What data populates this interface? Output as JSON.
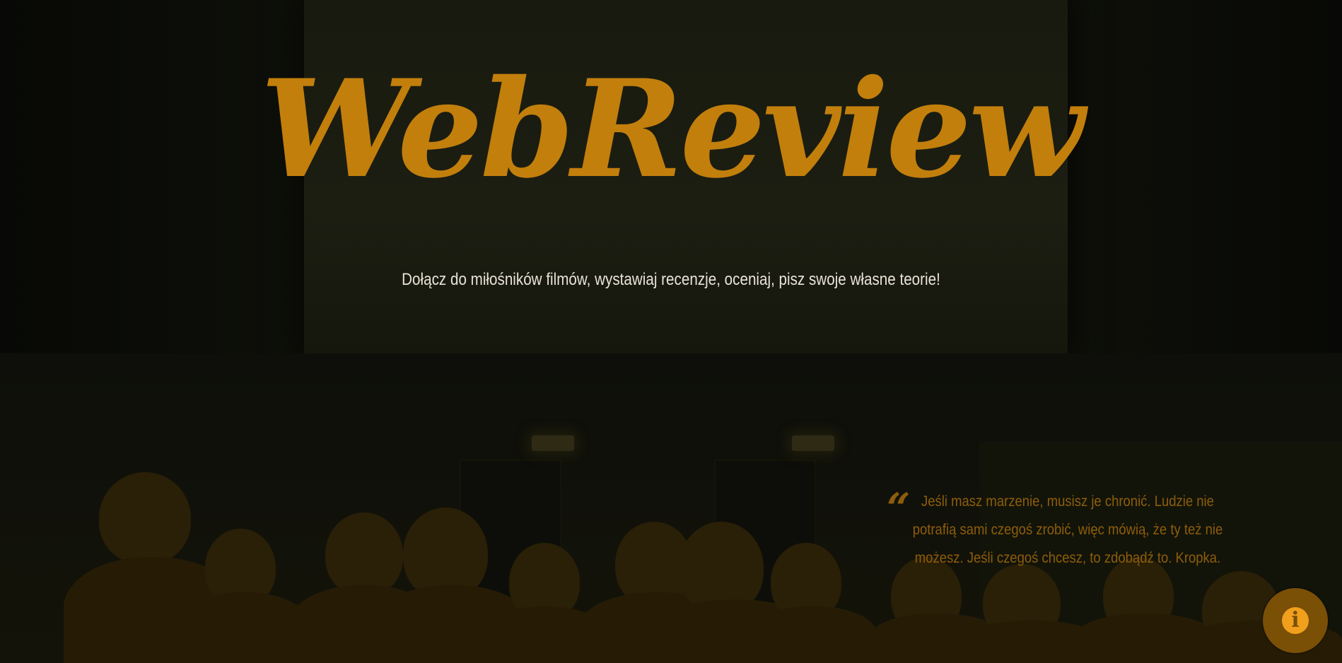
{
  "hero": {
    "logo_text": "WebReview",
    "tagline": "Dołącz do miłośników filmów, wystawiaj recenzje, oceniaj, pisz swoje własne teorie!"
  },
  "quote": {
    "mark": "“",
    "text": "Jeśli masz marzenie, musisz je chronić. Ludzie nie potrafią sami czegoś zrobić, więc mówią, że ty też nie możesz. Jeśli czegoś chcesz, to zdobądź to. Kropka."
  },
  "info_button": {
    "icon": "info-icon",
    "glyph": "i"
  },
  "colors": {
    "accent": "#c27f0c",
    "quote": "#8e5d0b",
    "tagline": "#e9e3d6",
    "background": "#0c0d08"
  }
}
